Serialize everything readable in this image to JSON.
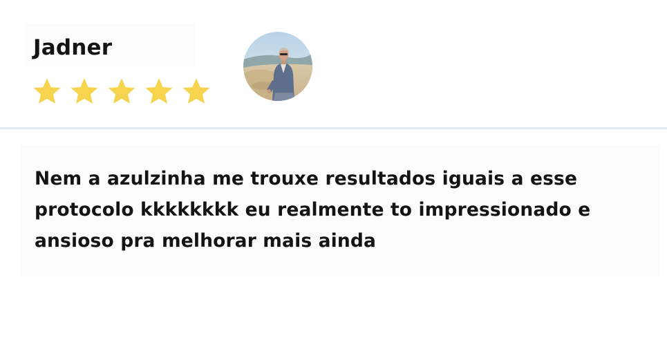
{
  "review": {
    "reviewer_name": "Jadner",
    "rating": 5,
    "max_rating": 5,
    "star_color": "#f6d44e",
    "avatar_icon": "reviewer-photo-beach",
    "text": "Nem a azulzinha me trouxe resultados iguais a esse protocolo kkkkkkkk eu realmente to impressionado e ansioso pra melhorar mais ainda"
  },
  "colors": {
    "text": "#141414",
    "divider": "#e6eaee",
    "background": "#ffffff"
  }
}
